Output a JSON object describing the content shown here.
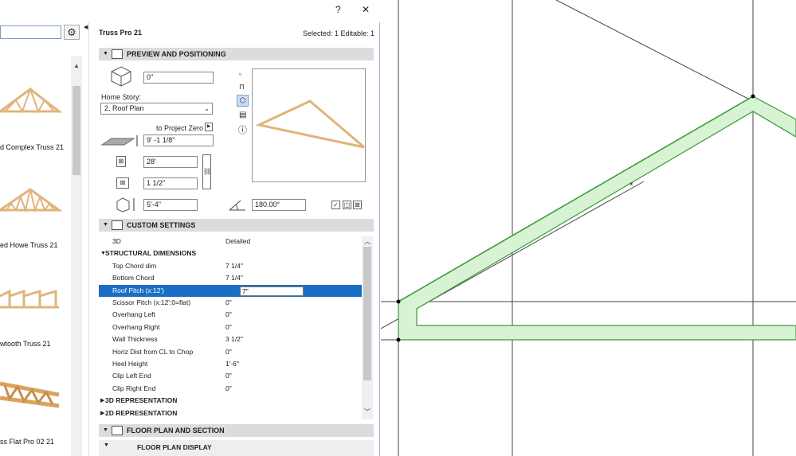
{
  "library": {
    "items": [
      {
        "label": "d Complex Truss 21"
      },
      {
        "label": "ed Howe Truss 21"
      },
      {
        "label": "wtooth Truss 21"
      },
      {
        "label": "ss Flat Pro 02 21"
      }
    ]
  },
  "dialog": {
    "title": "Truss Pro 21",
    "status": "Selected: 1 Editable: 1",
    "help_label": "?",
    "close_label": "✕",
    "preview_section": {
      "label": "PREVIEW AND POSITIONING",
      "elevation_value": "0\"",
      "home_story_label": "Home Story:",
      "home_story_value": "2. Roof Plan",
      "to_project_zero_label": "to Project Zero",
      "project_zero_value": "9' -1 1/8\"",
      "width_value": "28'",
      "depth_value": "1 1/2\"",
      "height_value": "5'-4\"",
      "angle_value": "180.00°"
    },
    "custom_section": {
      "label": "CUSTOM SETTINGS",
      "rows": [
        {
          "name": "3D",
          "value": "Detailed",
          "kind": "plain"
        },
        {
          "name": "STRUCTURAL DIMENSIONS",
          "value": "",
          "kind": "section-open"
        },
        {
          "name": "Top Chord dim",
          "value": "7 1/4\"",
          "kind": "item"
        },
        {
          "name": "Bottom Chord",
          "value": "7 1/4\"",
          "kind": "item"
        },
        {
          "name": "Roof Pitch (x:12')",
          "value": "7\"",
          "kind": "selected"
        },
        {
          "name": "Scissor Pitch (x:12';0=flat)",
          "value": "0\"",
          "kind": "item"
        },
        {
          "name": "Overhang Left",
          "value": "0\"",
          "kind": "item"
        },
        {
          "name": "Overhang Right",
          "value": "0\"",
          "kind": "item"
        },
        {
          "name": "Wall Thickness",
          "value": "3 1/2\"",
          "kind": "item"
        },
        {
          "name": "Horiz Dist from CL to Chop",
          "value": "0\"",
          "kind": "item"
        },
        {
          "name": "Heel Height",
          "value": "1'-6\"",
          "kind": "item"
        },
        {
          "name": "Clip Left End",
          "value": "0\"",
          "kind": "item"
        },
        {
          "name": "Clip Right End",
          "value": "0\"",
          "kind": "item"
        },
        {
          "name": "3D REPRESENTATION",
          "value": "",
          "kind": "section-closed"
        },
        {
          "name": "2D REPRESENTATION",
          "value": "",
          "kind": "section-closed"
        }
      ]
    },
    "floor_section": {
      "label": "FLOOR PLAN AND SECTION",
      "sub_label": "FLOOR PLAN DISPLAY"
    }
  },
  "colors": {
    "accent": "#1a6fc4",
    "truss_wood": "#e0b47a",
    "roof_fill": "#d8f2d4",
    "roof_stroke": "#3a9a3a"
  }
}
